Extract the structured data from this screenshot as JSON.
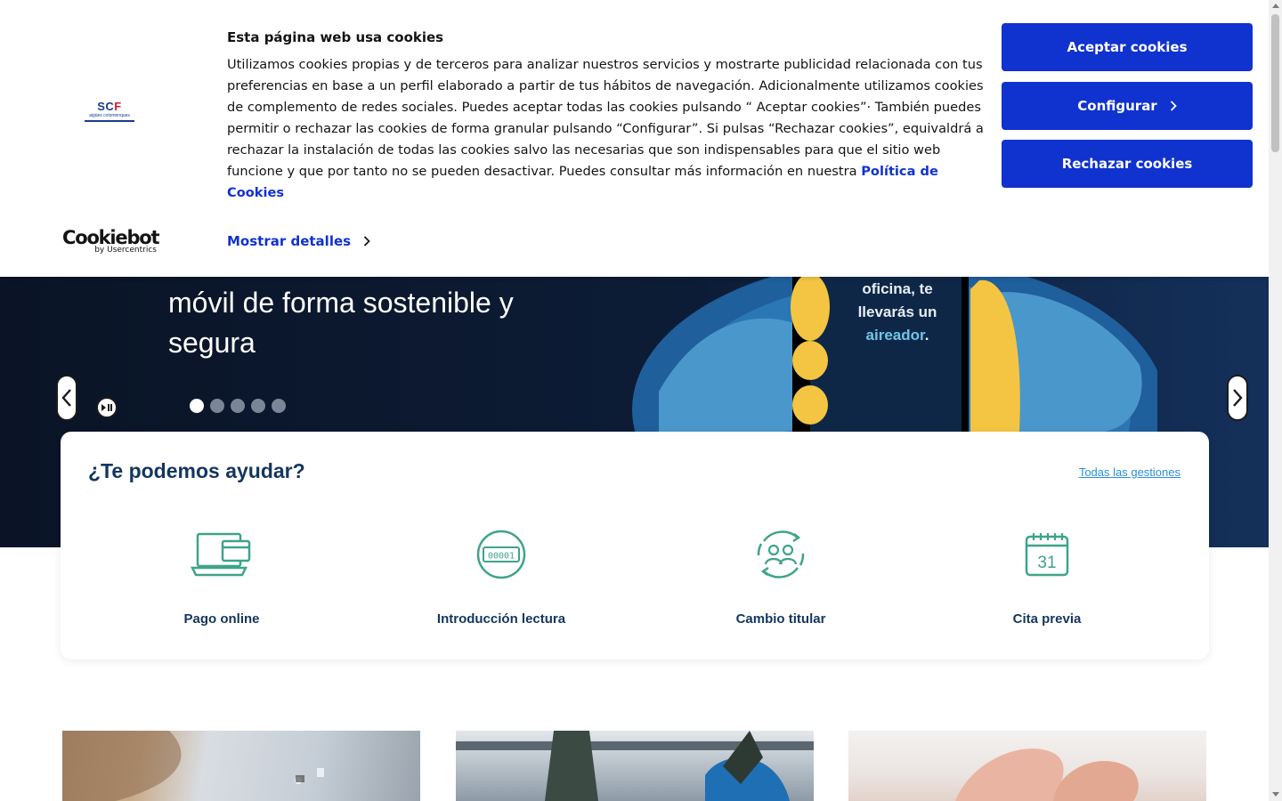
{
  "cookie_banner": {
    "logo": {
      "name": "SCF",
      "subtitle": "aigües colomenques"
    },
    "title": "Esta página web usa cookies",
    "text": "Utilizamos cookies propias y de terceros para analizar nuestros servicios y mostrarte publicidad relacionada con tus preferencias en base a un perfil elaborado a partir de tus hábitos de navegación. Adicionalmente utilizamos cookies de complemento de redes sociales.  Puedes aceptar todas las cookies pulsando “ Aceptar cookies”· También puedes permitir o rechazar las cookies de forma granular pulsando “Configurar”.  Si pulsas “Rechazar cookies”, equivaldrá a rechazar la instalación de todas las cookies salvo las necesarias que son indispensables para que el sitio web funcione y que por tanto no se pueden desactivar. Puedes consultar más información en nuestra",
    "policy_link": "Política de Cookies",
    "details_link": "Mostrar detalles",
    "accept_button": "Aceptar cookies",
    "configure_button": "Configurar",
    "reject_button": "Rechazar cookies",
    "provider": {
      "name": "Cookiebot",
      "by": "by Usercentrics"
    },
    "button_color": "#1032cf"
  },
  "hero": {
    "headline_visible": "móvil de forma sostenible y segura",
    "phone_text_before": "oficina, te llevarás un",
    "phone_text_highlight": "aireador",
    "phone_text_after": ".",
    "slides_total": 5,
    "active_slide": 1,
    "icons": {
      "prev": "chevron-left-icon",
      "next": "chevron-right-icon",
      "play_pause": "play-pause-icon"
    }
  },
  "help": {
    "title": "¿Te podemos ayudar?",
    "all_link": "Todas las gestiones",
    "items": [
      {
        "label": "Pago online",
        "icon": "laptop-wallet-icon"
      },
      {
        "label": "Introducción lectura",
        "icon": "meter-reading-icon"
      },
      {
        "label": "Cambio titular",
        "icon": "owner-change-icon"
      },
      {
        "label": "Cita previa",
        "icon": "calendar-icon"
      }
    ],
    "icon_color": "#3fa38a",
    "title_color": "#14365e"
  }
}
